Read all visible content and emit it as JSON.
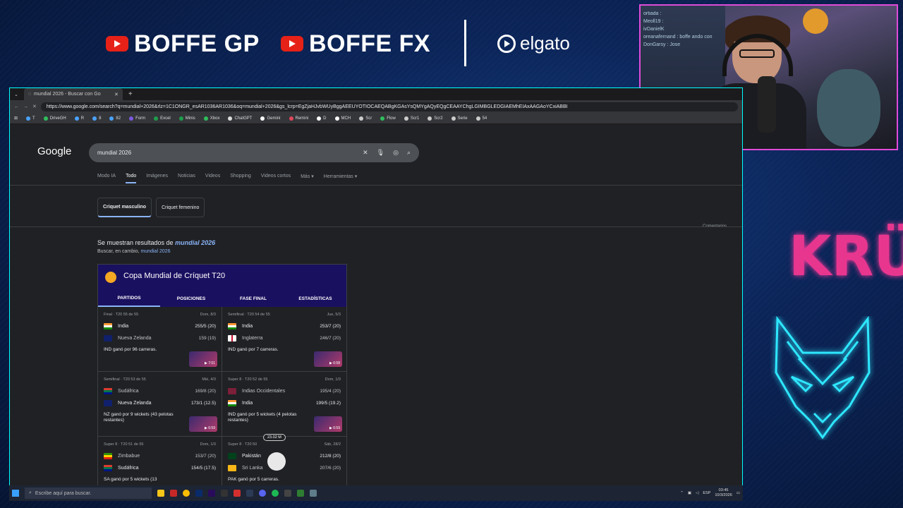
{
  "banner": {
    "brand1": "BOFFE GP",
    "brand2": "BOFFE FX",
    "sponsor": "elgato"
  },
  "webcam": {
    "chat_lines": [
      "ortiada :",
      "Meoll19 :",
      "ivDanielK",
      "oreanafernand : boffe ando con",
      "DonGarsy : Jose"
    ]
  },
  "right_panel": {
    "logo_text": "KRÜ"
  },
  "browser": {
    "tab_title": "mundial 2026 - Buscar con Go",
    "url": "https://www.google.com/search?q=mundial+2026&rlz=1C1ONGR_esAR1036AR1036&oq=mundial+2026&gs_lcrp=EgZjaHJvbWUyBggAEEUYOTIOCAEQABgKGAsYsQMYgAQyEQgCEAAYChgLGIMBGLEDGIAEMhEIAxAAGAoYCxiABBI",
    "bookmarks": [
      "T",
      "DriveGH",
      "R",
      "8",
      "82",
      "Form",
      "Excel",
      "Minis",
      "Xbox",
      "ChatGPT",
      "Gemini",
      "Remini",
      "D",
      "MCH",
      "Scr",
      "Flow",
      "Scr1",
      "Scr2",
      "Serie",
      "54"
    ]
  },
  "google": {
    "logo": "Google",
    "query": "mundial 2026",
    "tabs": [
      "Modo IA",
      "Todo",
      "Imágenes",
      "Noticias",
      "Videos",
      "Shopping",
      "Videos cortos",
      "Más ▾",
      "Herramientas ▾"
    ],
    "chips": [
      "Criquet masculino",
      "Criquet femenino"
    ],
    "comments": "Comentarios",
    "shown_prefix": "Se muestran resultados de",
    "shown_query": "mundial 2026",
    "instead_prefix": "Buscar, en cambio,",
    "instead_query": "mundial 2026"
  },
  "card": {
    "title": "Copa Mundial de Críquet T20",
    "tabs": [
      "PARTIDOS",
      "POSICIONES",
      "FASE FINAL",
      "ESTADÍSTICAS"
    ],
    "matches": [
      {
        "stage": "Final · T20 55 de 55",
        "date": "Dom, 8/3",
        "t1": "India",
        "s1": "255/5 (20)",
        "t2": "Nueva Zelanda",
        "s2": "159 (19)",
        "result": "IND ganó por 96 carreras.",
        "dur": "▶ 7:01"
      },
      {
        "stage": "Semifinal · T20 54 de 55",
        "date": "Jue, 5/3",
        "t1": "India",
        "s1": "253/7 (20)",
        "t2": "Inglaterra",
        "s2": "246/7 (20)",
        "result": "IND ganó por 7 carreras.",
        "dur": "▶ 6:58"
      },
      {
        "stage": "Semifinal · T20 53 de 55",
        "date": "Mié, 4/3",
        "t1": "Sudáfrica",
        "s1": "169/8 (20)",
        "t2": "Nueva Zelanda",
        "s2": "173/1 (12.5)",
        "result": "NZ ganó por 9 wickets (43 pelotas restantes)",
        "dur": "▶ 6:59"
      },
      {
        "stage": "Super 8 · T20 52 de 55",
        "date": "Dom, 1/3",
        "t1": "Indias Occidentales",
        "s1": "195/4 (20)",
        "t2": "India",
        "s2": "199/5 (19.2)",
        "result": "IND ganó por 5 wickets (4 pelotas restantes)",
        "dur": "▶ 6:59"
      },
      {
        "stage": "Super 8 · T20 51 de 55",
        "date": "Dom, 1/3",
        "t1": "Zimbabue",
        "s1": "153/7 (20)",
        "t2": "Sudáfrica",
        "s2": "154/5 (17.5)",
        "result": "SA ganó por 5 wickets (13",
        "dur": ""
      },
      {
        "stage": "Super 8 · T20 50",
        "date": "Sáb, 28/2",
        "t1": "Pakistán",
        "s1": "212/8 (20)",
        "t2": "Sri Lanka",
        "s2": "207/6 (20)",
        "result": "PAK ganó por 5 carreras.",
        "dur": ""
      }
    ],
    "overlay_badge": "23.02 M"
  },
  "taskbar": {
    "search_placeholder": "Escribe aquí para buscar.",
    "lang": "ESP",
    "time": "03:45",
    "date": "10/3/2026"
  }
}
